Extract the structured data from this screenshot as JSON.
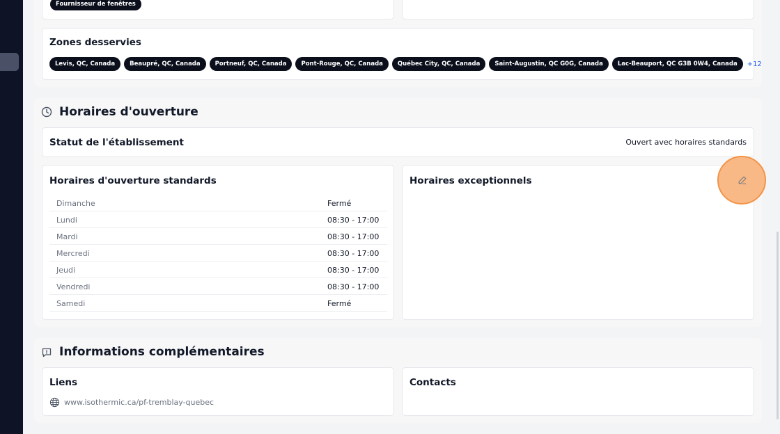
{
  "top_card": {
    "supplier_tag": "Fournisseur de fenêtres"
  },
  "service_areas": {
    "title": "Zones desservies",
    "chips": [
      "Levis, QC, Canada",
      "Beaupré, QC, Canada",
      "Portneuf, QC, Canada",
      "Pont-Rouge, QC, Canada",
      "Québec City, QC, Canada",
      "Saint-Augustin, QC G0G, Canada",
      "Lac-Beauport, QC G3B 0W4, Canada"
    ],
    "more": "+12"
  },
  "opening_hours": {
    "title": "Horaires d'ouverture",
    "status_label": "Statut de l'établissement",
    "status_value": "Ouvert avec horaires standards",
    "standard_title": "Horaires d'ouverture standards",
    "exceptional_title": "Horaires exceptionnels",
    "days": [
      {
        "day": "Dimanche",
        "hours": "Fermé"
      },
      {
        "day": "Lundi",
        "hours": "08:30 - 17:00"
      },
      {
        "day": "Mardi",
        "hours": "08:30 - 17:00"
      },
      {
        "day": "Mercredi",
        "hours": "08:30 - 17:00"
      },
      {
        "day": "Jeudi",
        "hours": "08:30 - 17:00"
      },
      {
        "day": "Vendredi",
        "hours": "08:30 - 17:00"
      },
      {
        "day": "Samedi",
        "hours": "Fermé"
      }
    ]
  },
  "additional_info": {
    "title": "Informations complémentaires",
    "links_title": "Liens",
    "link_url": "www.isothermic.ca/pf-tremblay-quebec",
    "contacts_title": "Contacts"
  },
  "colors": {
    "accent_orange": "#f39448",
    "chip_bg": "#0b0f1c",
    "link_blue": "#2563eb",
    "sidebar_bg": "#0f1326"
  }
}
